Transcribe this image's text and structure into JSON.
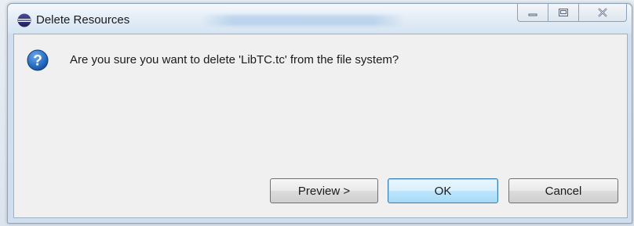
{
  "window": {
    "title": "Delete Resources",
    "app_icon": "eclipse-icon",
    "caption_buttons": [
      "minimize-icon",
      "maximize-icon",
      "close-icon"
    ]
  },
  "dialog": {
    "icon": "question-icon",
    "message": "Are you sure you want to delete 'LibTC.tc' from the file system?"
  },
  "buttons": {
    "preview": "Preview >",
    "ok": "OK",
    "cancel": "Cancel"
  },
  "colors": {
    "question_icon": "#1f5fae",
    "ok_border": "#3c7fb1"
  }
}
